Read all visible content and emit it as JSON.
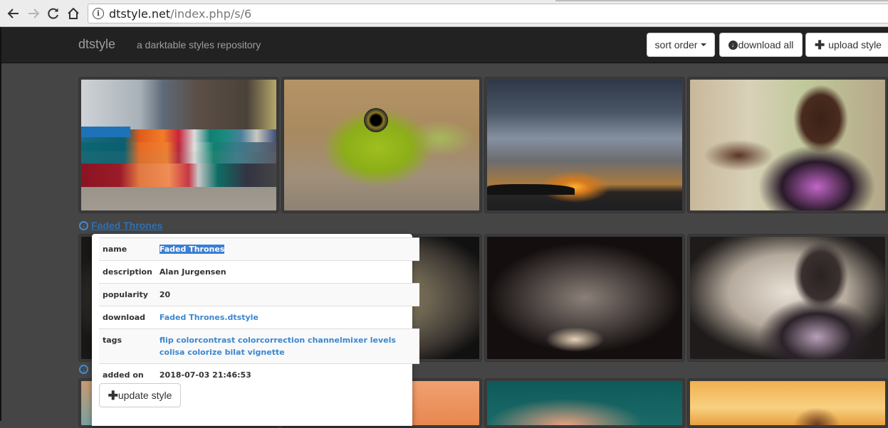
{
  "browser": {
    "url_host": "dtstyle.net",
    "url_path": "/index.php/s/6",
    "icons": [
      "back-arrow-icon",
      "forward-arrow-icon",
      "reload-icon",
      "home-icon",
      "info-icon"
    ]
  },
  "navbar": {
    "brand": "dtstyle",
    "tagline": "a darktable styles repository",
    "sort_label": "sort order",
    "download_all_label": "download all",
    "upload_label": "upload style"
  },
  "gallery": {
    "rows": [
      {
        "tiles": [
          "trucks-original",
          "frog-original",
          "sunset-original",
          "girl-original"
        ]
      },
      {
        "tiles": [
          "trucks-faded",
          "frog-faded",
          "sunset-faded",
          "girl-faded"
        ]
      },
      {
        "tiles": [
          "trucks-next",
          "frog-next",
          "sunset-next",
          "girl-next"
        ]
      }
    ]
  },
  "style": {
    "title": "Faded Thrones",
    "details": {
      "name_label": "name",
      "name_value": "Faded Thrones",
      "description_label": "description",
      "description_value": "Alan Jurgensen",
      "popularity_label": "popularity",
      "popularity_value": "20",
      "download_label": "download",
      "download_value": "Faded Thrones.dtstyle",
      "tags_label": "tags",
      "tags": [
        "flip",
        "colorcontrast",
        "colorcorrection",
        "channelmixer",
        "levels",
        "colisa",
        "colorize",
        "bilat",
        "vignette"
      ],
      "added_label": "added on",
      "added_value": "2018-07-03 21:46:53"
    },
    "update_label": "update style"
  },
  "colors": {
    "accent_link": "#3c87cf",
    "selection": "#3a7fd5",
    "navbar_bg": "#222222",
    "page_bg": "#454545"
  }
}
